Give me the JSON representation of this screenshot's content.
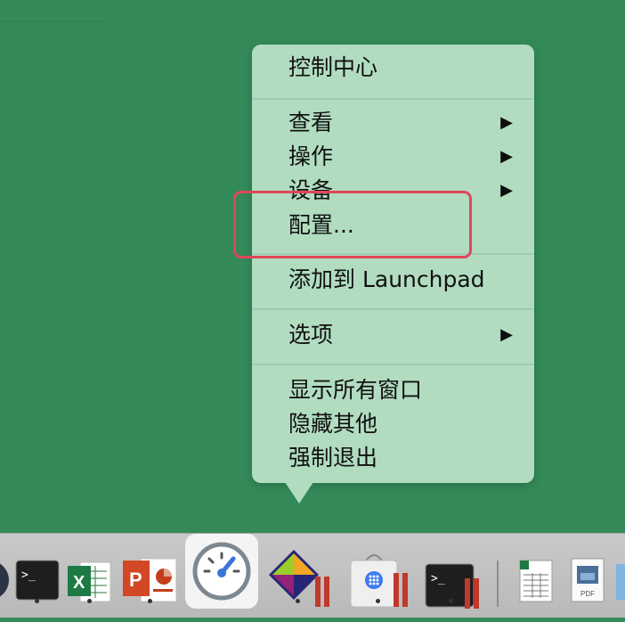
{
  "menu": {
    "title": "控制中心",
    "items": [
      {
        "label": "查看",
        "submenu_arrow": "▶"
      },
      {
        "label": "操作",
        "submenu_arrow": "▶"
      },
      {
        "label": "设备",
        "submenu_arrow": "▶"
      },
      {
        "label": "配置..."
      },
      {
        "label": "添加到 Launchpad"
      },
      {
        "label": "选项",
        "submenu_arrow": "▶"
      },
      {
        "label": "显示所有窗口"
      },
      {
        "label": "隐藏其他"
      },
      {
        "label": "强制退出"
      }
    ]
  },
  "highlight": {
    "color": "#e0465a",
    "target": "配置..."
  },
  "dock": {
    "icons": [
      {
        "name": "user-avatar-icon"
      },
      {
        "name": "terminal-icon",
        "text": ">_"
      },
      {
        "name": "excel-icon",
        "text": "X"
      },
      {
        "name": "powerpoint-icon",
        "text": "P"
      },
      {
        "name": "speedometer-icon"
      },
      {
        "name": "centos-vm-icon"
      },
      {
        "name": "app-store-bag-vm-icon"
      },
      {
        "name": "terminal-vm-icon",
        "text": ">_"
      },
      {
        "name": "spreadsheet-doc-icon"
      },
      {
        "name": "pdf-doc-icon",
        "text": "PDF"
      },
      {
        "name": "folder-icon"
      }
    ]
  }
}
